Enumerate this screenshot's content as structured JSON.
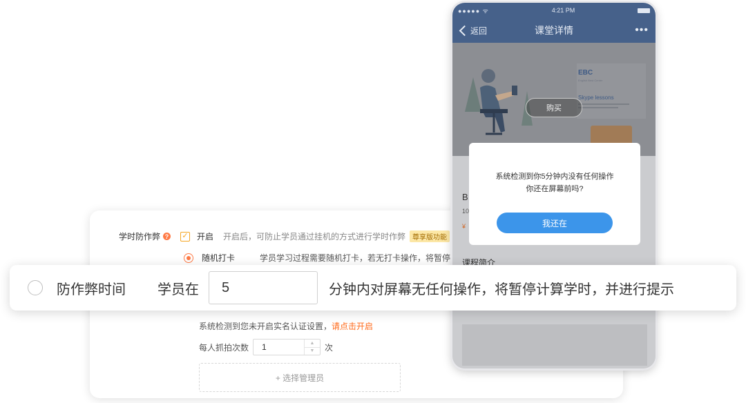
{
  "settings": {
    "anti_cheat_label": "学时防作弊",
    "help_icon": "?",
    "enable_checkbox_mark": "✓",
    "enable_label": "开启",
    "enable_hint": "开启后，可防止学员通过挂机的方式进行学时作弊",
    "premium_badge": "尊享版功能",
    "random_checkin_label": "随机打卡",
    "random_checkin_desc": "学员学习过程需要随机打卡，若无打卡操作，将暂停",
    "verify_notice": "系统检测到您未开启实名认证设置，",
    "verify_link": "请点击开启",
    "capture_label": "每人抓拍次数",
    "capture_value": "1",
    "capture_unit": "次",
    "add_manager_button": "+ 选择管理员"
  },
  "strip": {
    "option_label": "防作弊时间",
    "prefix": "学员在",
    "minutes_value": "5",
    "suffix": "分钟内对屏幕无任何操作，将暂停计算学时，并进行提示"
  },
  "phone": {
    "status_signal": "●●●●● ᯤ",
    "time": "4:21 PM",
    "back_label": "返回",
    "nav_title": "课堂详情",
    "more": "•••",
    "banner_brand": "EBC",
    "banner_tagline": "English Best Center",
    "banner_heading": "Skype lessons",
    "buy_button": "购买",
    "course_title_partial": "B",
    "course_sub_partial": "10",
    "price_partial": "¥",
    "section_title": "课程简介",
    "alert_line1": "系统检测到你5分钟内没有任何操作",
    "alert_line2": "你还在屏幕前吗?",
    "alert_button": "我还在"
  }
}
